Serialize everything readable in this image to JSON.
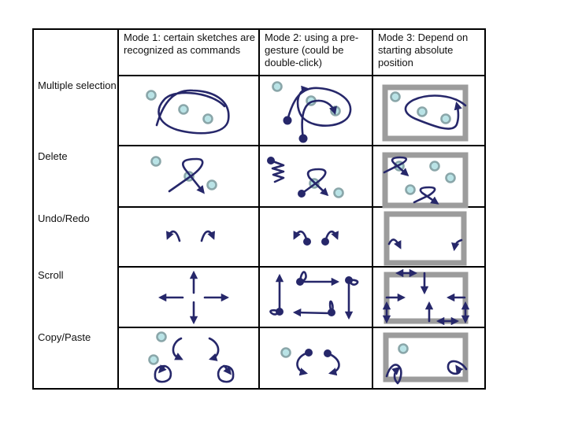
{
  "table": {
    "columns": [
      "",
      "Mode 1: certain sketches are recognized as commands",
      "Mode 2: using a pre-gesture (could be double-click)",
      "Mode 3: Depend on starting absolute position"
    ],
    "rows": [
      {
        "label": "Multiple selection",
        "gesture": "lasso-around-objects"
      },
      {
        "label": "Delete",
        "gesture": "pigtail-cross-out"
      },
      {
        "label": "Undo/Redo",
        "gesture": "curved-hook-arrows"
      },
      {
        "label": "Scroll",
        "gesture": "directional-straight-arrows"
      },
      {
        "label": "Copy/Paste",
        "gesture": "curved-arrows-with-loops"
      }
    ]
  },
  "colors": {
    "ink": "#26276a",
    "object_fill": "#b9e3e6",
    "object_stroke": "#8aa6a9",
    "frame": "#9c9c9c",
    "grid": "#000000"
  }
}
